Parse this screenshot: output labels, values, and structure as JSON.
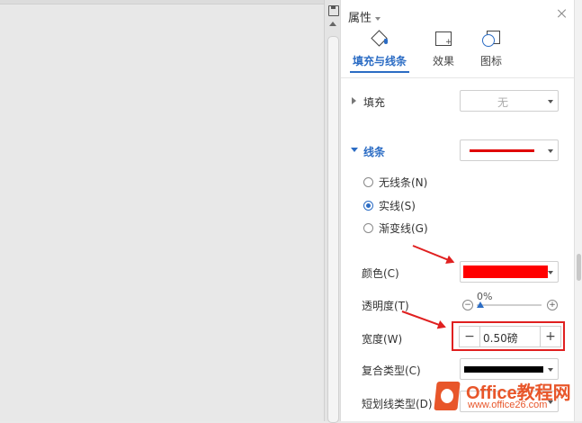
{
  "panel": {
    "title": "属性",
    "tabs": [
      {
        "label": "填充与线条",
        "icon": "fill-bucket-icon",
        "active": true
      },
      {
        "label": "效果",
        "icon": "effect-icon",
        "active": false
      },
      {
        "label": "图标",
        "icon": "chart-icon",
        "active": false
      }
    ],
    "fill": {
      "label": "填充",
      "value": "无"
    },
    "line": {
      "label": "线条",
      "color": "#e00000",
      "options": [
        {
          "label": "无线条(N)",
          "checked": false
        },
        {
          "label": "实线(S)",
          "checked": true
        },
        {
          "label": "渐变线(G)",
          "checked": false
        }
      ]
    },
    "color_label": "颜色(C)",
    "color_value": "#ff0000",
    "transparency_label": "透明度(T)",
    "transparency_value": "0%",
    "width_label": "宽度(W)",
    "width_value": "0.50磅",
    "compound_label": "复合类型(C)",
    "dash_label": "短划线类型(D)"
  },
  "watermark": {
    "text": "Office教程网",
    "url": "www.office26.com"
  }
}
